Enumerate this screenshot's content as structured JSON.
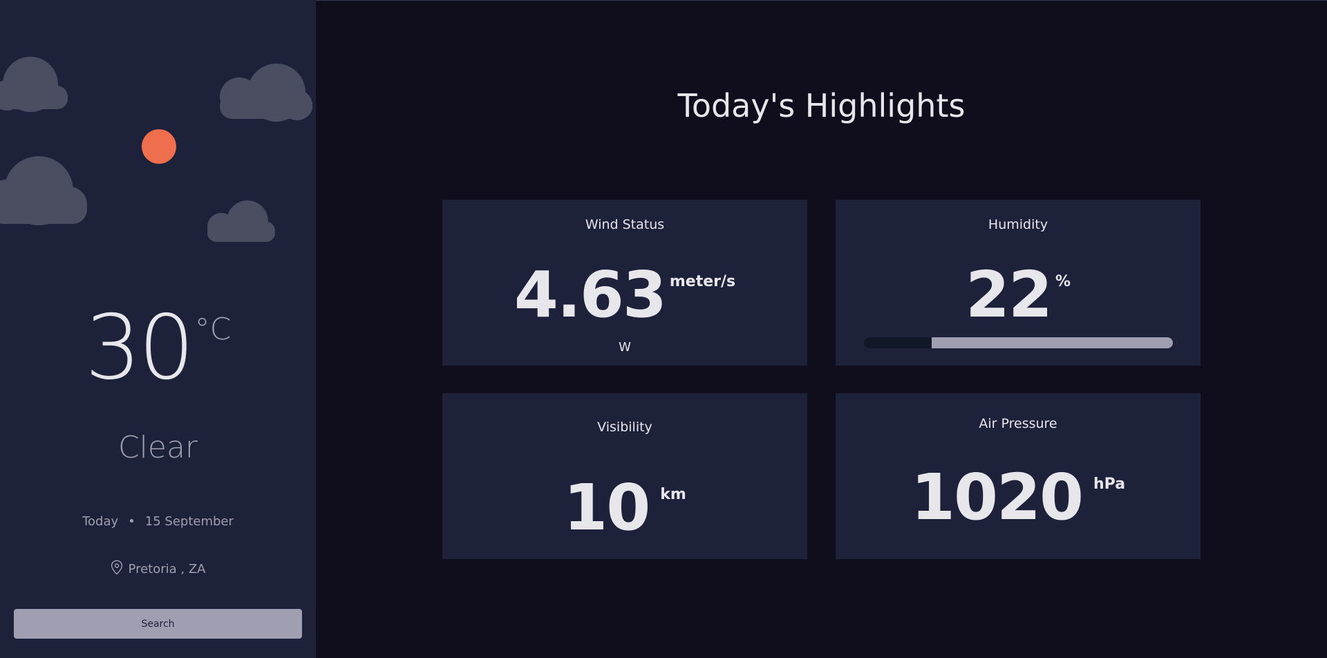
{
  "sidebar": {
    "icons": {
      "clouds": "cloud-icon",
      "sun": "sun-icon",
      "location": "location-pin-icon"
    },
    "temperature": {
      "value": "30",
      "unit": "°C"
    },
    "condition": "Clear",
    "date": {
      "day": "Today",
      "separator": "•",
      "date": "15 September"
    },
    "location": "Pretoria , ZA",
    "search_label": "Search"
  },
  "main": {
    "title": "Today's Highlights",
    "wind": {
      "label": "Wind Status",
      "value": "4.63",
      "unit": "meter/s",
      "direction": "W"
    },
    "humidity": {
      "label": "Humidity",
      "value": "22",
      "unit": "%",
      "percent": 22
    },
    "visibility": {
      "label": "Visibility",
      "value": "10",
      "unit": "km"
    },
    "pressure": {
      "label": "Air Pressure",
      "value": "1020",
      "unit": "hPa"
    }
  },
  "colors": {
    "page_bg": "#100e1d",
    "panel_bg": "#1e213a",
    "sun": "#ee6e4d",
    "cloud": "#4b4e60",
    "text": "#e7e7eb",
    "muted": "#a09fb1"
  }
}
